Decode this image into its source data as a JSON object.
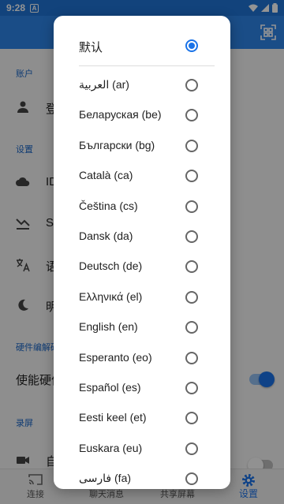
{
  "status_bar": {
    "time": "9:28",
    "notif_letter": "A"
  },
  "colors": {
    "accent": "#2e86e8",
    "radio_on": "#1a73e8",
    "section": "#1a66c7"
  },
  "settings": {
    "section_account": "账户",
    "login_label": "登",
    "section_settings": "设置",
    "id_label": "ID",
    "s_label": "Sc",
    "lang_label": "语",
    "theme_label": "明",
    "section_hw": "硬件编解码",
    "hw_label": "使能硬件",
    "section_rec": "录屏",
    "rec_label": "自"
  },
  "bottom_nav": {
    "connect": "连接",
    "chat": "聊天消息",
    "share": "共享屏幕",
    "settings": "设置"
  },
  "dialog": {
    "default_label": "默认",
    "selected_index": 0,
    "languages": [
      "العربية (ar)",
      "Беларуская (be)",
      "Български (bg)",
      "Català (ca)",
      "Čeština (cs)",
      "Dansk (da)",
      "Deutsch (de)",
      "Ελληνικά (el)",
      "English (en)",
      "Esperanto (eo)",
      "Español (es)",
      "Eesti keel (et)",
      "Euskara (eu)",
      "فارسی (fa)"
    ]
  }
}
